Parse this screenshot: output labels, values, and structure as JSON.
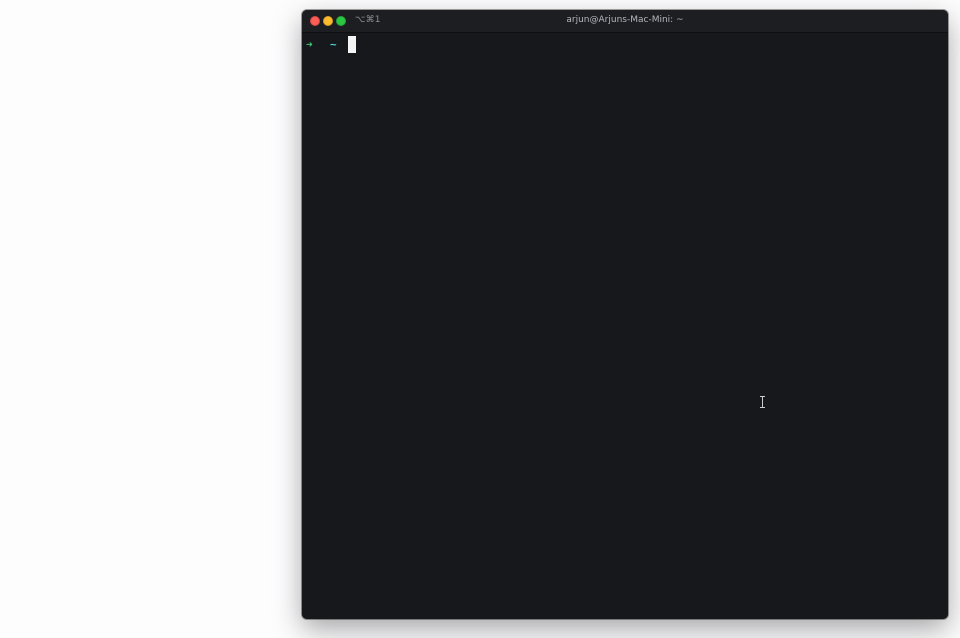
{
  "window": {
    "title": "arjun@Arjuns-Mac-Mini: ~",
    "tab_shortcut": "⌥⌘1",
    "controls": {
      "close_icon": "close-icon",
      "minimize_icon": "minimize-icon",
      "zoom_icon": "zoom-icon"
    }
  },
  "terminal": {
    "prompt_arrow": "➜",
    "prompt_dir": "~",
    "input": ""
  },
  "colors": {
    "terminal_bg": "#16181b",
    "titlebar_bg": "#1c1e21",
    "prompt_arrow": "#3fc37a",
    "prompt_dir": "#4fd5d0",
    "close": "#fd5f57",
    "minimize": "#febc2e",
    "zoom": "#2ac840"
  },
  "cursor_icon": "text-cursor-icon"
}
